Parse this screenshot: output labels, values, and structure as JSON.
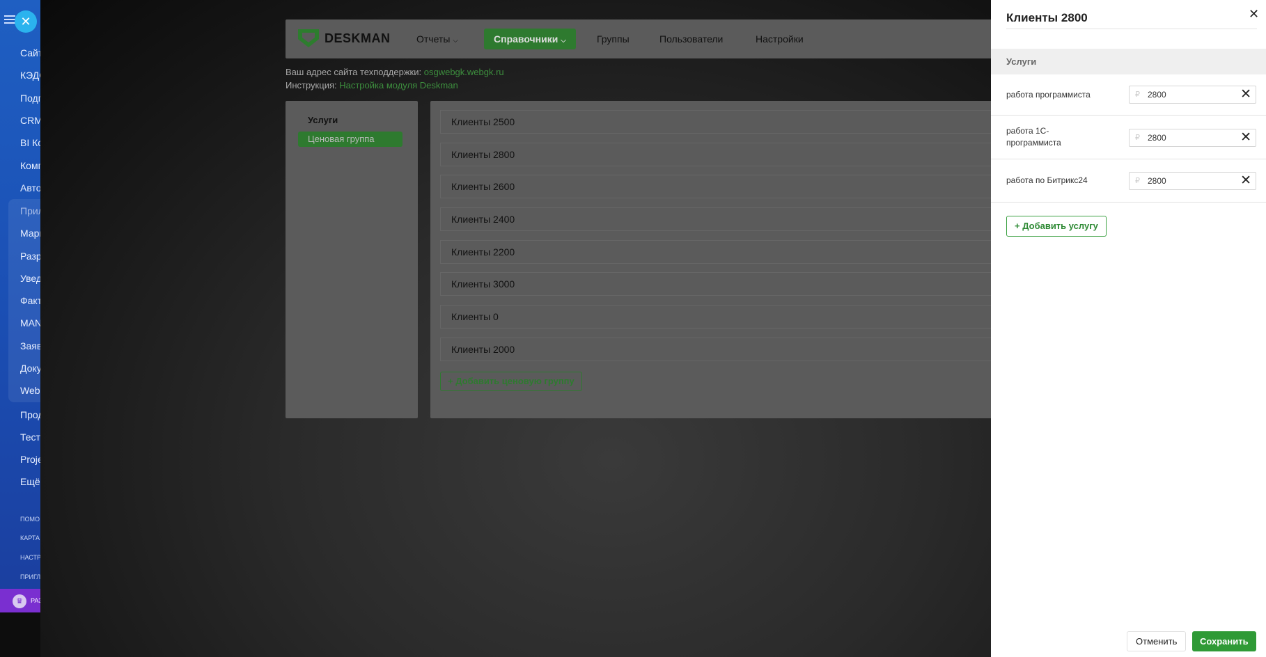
{
  "bitrix_sidebar": {
    "items": [
      "Сайт",
      "КЭДО",
      "Подп",
      "CRM",
      "BI Ко",
      "Комп",
      "Авто",
      "Прил",
      "Марк",
      "Разр",
      "Увед",
      "Факт",
      "MAN",
      "Заяв",
      "Доку",
      "Web",
      "Прод",
      "Тест",
      "Proje",
      "Ещё"
    ],
    "footer_items": [
      "помо",
      "карта",
      "настр",
      "пригл"
    ],
    "user_label": "РАЗ"
  },
  "app": {
    "logo_text": "DESKMAN",
    "nav": {
      "reports": "Отчеты",
      "references": "Справочники",
      "groups": "Группы",
      "users": "Пользователи",
      "settings": "Настройки"
    },
    "support": {
      "label": "Ваш адрес сайта техподдержки:",
      "link": "osgwebgk.webgk.ru"
    },
    "instruction": {
      "label": "Инструкция:",
      "link": "Настройка модуля Deskman"
    },
    "left_menu": {
      "title": "Услуги",
      "selected": "Ценовая группа"
    },
    "price_groups": [
      "Клиенты 2500",
      "Клиенты 2800",
      "Клиенты 2600",
      "Клиенты 2400",
      "Клиенты 2200",
      "Клиенты 3000",
      "Клиенты 0",
      "Клиенты 2000"
    ],
    "add_group_label": "+ Добавить ценовую группу"
  },
  "slider": {
    "title": "Клиенты 2800",
    "section_title": "Услуги",
    "currency_symbol": "₽",
    "services": [
      {
        "name": "работа программиста",
        "price": "2800"
      },
      {
        "name": "работа 1С-программиста",
        "price": "2800"
      },
      {
        "name": "работа по Битрикс24",
        "price": "2800"
      }
    ],
    "add_service_label": "+ Добавить услугу",
    "cancel_label": "Отменить",
    "save_label": "Сохранить"
  }
}
